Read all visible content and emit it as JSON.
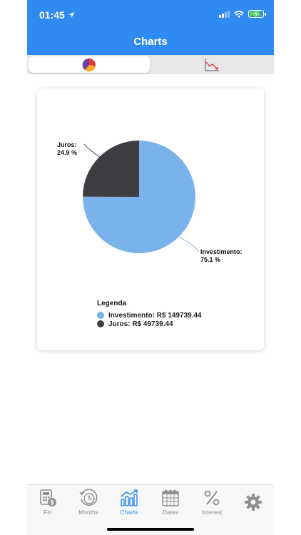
{
  "status_bar": {
    "time": "01:45"
  },
  "header": {
    "title": "Charts"
  },
  "segments": [
    {
      "icon": "pie-chart-icon",
      "selected": true
    },
    {
      "icon": "line-chart-icon",
      "selected": false
    }
  ],
  "chart_data": {
    "type": "pie",
    "title": "",
    "slices": [
      {
        "name": "Investimento",
        "value": 149739.44,
        "percent": 75.1,
        "color": "#7ab3ec"
      },
      {
        "name": "Juros",
        "value": 49739.44,
        "percent": 24.9,
        "color": "#3d3d42"
      }
    ],
    "slice_labels": [
      {
        "name": "Investimento:",
        "percent": "75.1 %"
      },
      {
        "name": "Juros:",
        "percent": "24.9 %"
      }
    ],
    "legend": {
      "title": "Legenda",
      "placement": "bottom",
      "items": [
        {
          "label": "Investimento: R$ 149739.44",
          "color": "#7ab3ec"
        },
        {
          "label": "Juros: R$ 49739.44",
          "color": "#3d3d42"
        }
      ]
    }
  },
  "tabbar": {
    "items": [
      {
        "label": "Fin",
        "icon": "calculator-dollar-icon",
        "active": false
      },
      {
        "label": "Months",
        "icon": "clock-history-icon",
        "active": false
      },
      {
        "label": "Charts",
        "icon": "bar-chart-icon",
        "active": true
      },
      {
        "label": "Dates",
        "icon": "calendar-icon",
        "active": false
      },
      {
        "label": "Interest",
        "icon": "percent-icon",
        "active": false
      },
      {
        "label": "",
        "icon": "gear-icon",
        "active": false
      }
    ]
  },
  "colors": {
    "accent": "#2f8bf1",
    "inactive": "#8e8e93"
  }
}
